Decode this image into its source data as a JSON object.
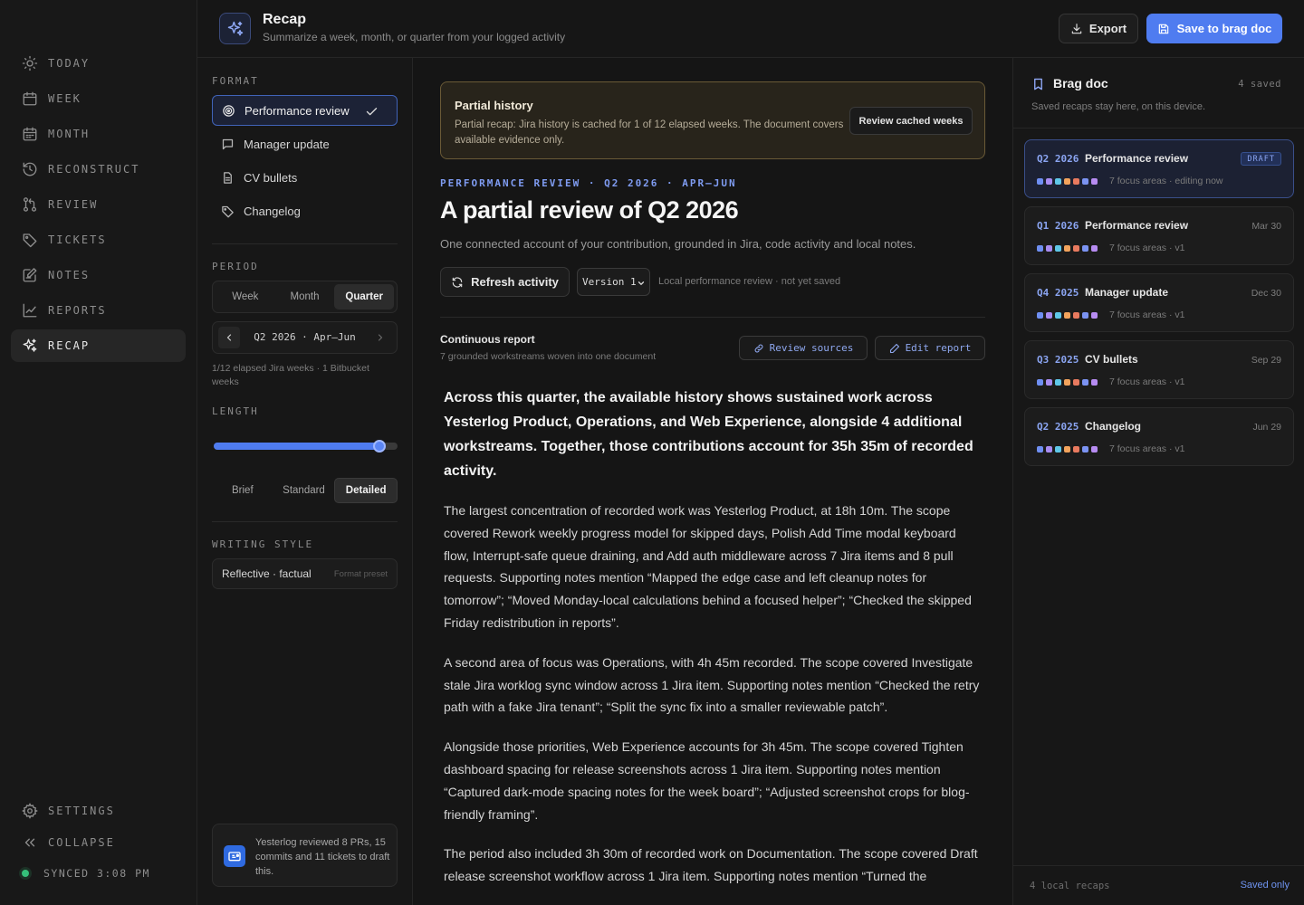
{
  "nav": {
    "items": [
      {
        "label": "TODAY",
        "icon": "sun-icon"
      },
      {
        "label": "WEEK",
        "icon": "calendar-icon"
      },
      {
        "label": "MONTH",
        "icon": "calendar-month-icon"
      },
      {
        "label": "RECONSTRUCT",
        "icon": "history-icon"
      },
      {
        "label": "REVIEW",
        "icon": "git-pull-request-icon"
      },
      {
        "label": "TICKETS",
        "icon": "tag-icon"
      },
      {
        "label": "NOTES",
        "icon": "notes-icon"
      },
      {
        "label": "REPORTS",
        "icon": "chart-line-icon"
      },
      {
        "label": "RECAP",
        "icon": "sparkle-icon",
        "active": true
      }
    ],
    "settings_label": "SETTINGS",
    "collapse_label": "COLLAPSE",
    "synced_label": "SYNCED 3:08 PM"
  },
  "header": {
    "title": "Recap",
    "subtitle": "Summarize a week, month, or quarter from your logged activity",
    "export_label": "Export",
    "save_label": "Save to brag doc"
  },
  "settings": {
    "format_label": "FORMAT",
    "formats": [
      "Performance review",
      "Manager update",
      "CV bullets",
      "Changelog"
    ],
    "period_label": "PERIOD",
    "periods": [
      "Week",
      "Month",
      "Quarter"
    ],
    "period_value": "Q2 2026 · Apr–Jun",
    "period_note": "1/12 elapsed Jira weeks · 1 Bitbucket weeks",
    "length_label": "LENGTH",
    "length_level": 0.9,
    "lengths": [
      "Brief",
      "Standard",
      "Detailed"
    ],
    "style_label": "WRITING STYLE",
    "style_value": "Reflective · factual",
    "style_preset": "Format preset",
    "review_note": "Yesterlog reviewed 8 PRs, 15 commits and 11 tickets to draft this."
  },
  "banner": {
    "title": "Partial history",
    "text": "Partial recap: Jira history is cached for 1 of 12 elapsed weeks. The document covers available evidence only.",
    "button": "Review cached weeks"
  },
  "doc": {
    "eyebrow": "PERFORMANCE REVIEW · Q2 2026 · APR–JUN",
    "title": "A partial review of Q2 2026",
    "description": "One connected account of your contribution, grounded in Jira, code activity and local notes.",
    "refresh_label": "Refresh activity",
    "version_label": "Version 1",
    "local_note": "Local performance review · not yet saved",
    "report_title": "Continuous report",
    "report_sub": "7 grounded workstreams woven into one document",
    "review_sources": "Review sources",
    "edit_report": "Edit report",
    "lead": "Across this quarter, the available history shows sustained work across Yesterlog Product, Operations, and Web Experience, alongside 4 additional workstreams. Together, those contributions account for 35h 35m of recorded activity.",
    "paragraphs": [
      "The largest concentration of recorded work was Yesterlog Product, at 18h 10m. The scope covered Rework weekly progress model for skipped days, Polish Add Time modal keyboard flow, Interrupt-safe queue draining, and Add auth middleware across 7 Jira items and 8 pull requests. Supporting notes mention “Mapped the edge case and left cleanup notes for tomorrow”; “Moved Monday-local calculations behind a focused helper”; “Checked the skipped Friday redistribution in reports”.",
      "A second area of focus was Operations, with 4h 45m recorded. The scope covered Investigate stale Jira worklog sync window across 1 Jira item. Supporting notes mention “Checked the retry path with a fake Jira tenant”; “Split the sync fix into a smaller reviewable patch”.",
      "Alongside those priorities, Web Experience accounts for 3h 45m. The scope covered Tighten dashboard spacing for release screenshots across 1 Jira item. Supporting notes mention “Captured dark-mode spacing notes for the week board”; “Adjusted screenshot crops for blog-friendly framing”.",
      "The period also included 3h 30m of recorded work on Documentation. The scope covered Draft release screenshot workflow across 1 Jira item. Supporting notes mention “Turned the"
    ]
  },
  "brag": {
    "title": "Brag doc",
    "count": "4 saved",
    "subtitle": "Saved recaps stay here, on this device.",
    "dot_colors": [
      "#6f8ff2",
      "#a98cf2",
      "#5fc7e8",
      "#f2a35c",
      "#e87a5f",
      "#7b93f2",
      "#b78cf2"
    ],
    "items": [
      {
        "q": "Q2 2026",
        "name": "Performance review",
        "date": "",
        "badge": "DRAFT",
        "meta": "7 focus areas · editing now",
        "active": true
      },
      {
        "q": "Q1 2026",
        "name": "Performance review",
        "date": "Mar 30",
        "meta": "7 focus areas · v1"
      },
      {
        "q": "Q4 2025",
        "name": "Manager update",
        "date": "Dec 30",
        "meta": "7 focus areas · v1"
      },
      {
        "q": "Q3 2025",
        "name": "CV bullets",
        "date": "Sep 29",
        "meta": "7 focus areas · v1"
      },
      {
        "q": "Q2 2025",
        "name": "Changelog",
        "date": "Jun 29",
        "meta": "7 focus areas · v1"
      }
    ],
    "footer_left": "4 local recaps",
    "footer_right": "Saved only"
  }
}
